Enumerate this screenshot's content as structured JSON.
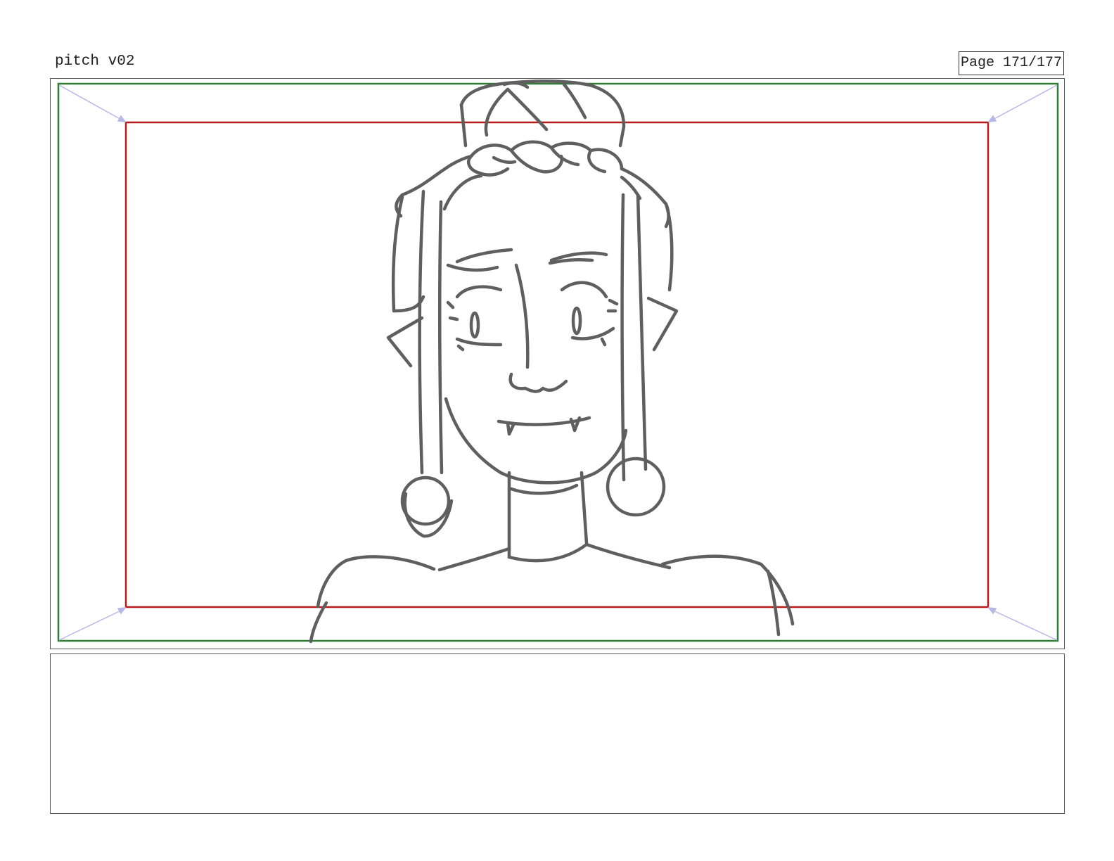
{
  "header": {
    "title": "pitch v02",
    "page_label": "Page 171/177"
  },
  "panel": {
    "safe_frame_color": "#2e7d32",
    "action_frame_color": "#b71c1c",
    "guide_arrow_color": "#b8b8e8",
    "sketch_color": "#5f5f5f",
    "sketch_subject": "character-sketch"
  },
  "notes": {
    "text": ""
  }
}
